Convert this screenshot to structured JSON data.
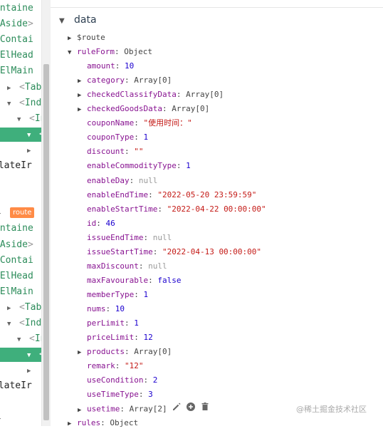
{
  "tree": {
    "rows": [
      {
        "text": "ontaine",
        "depth": 0,
        "kind": "name"
      },
      {
        "text": "lAside",
        "depth": 0,
        "kind": "name",
        "suffix": ">"
      },
      {
        "text": "lContai",
        "depth": 0,
        "kind": "name"
      },
      {
        "text": "ElHead",
        "depth": 0,
        "kind": "name",
        "prefix": "<"
      },
      {
        "text": "ElMain",
        "depth": 0,
        "kind": "name",
        "prefix": "<"
      },
      {
        "text": "Tab>",
        "depth": 1,
        "kind": "name",
        "prefix": "<",
        "arrow": "right"
      },
      {
        "text": "Inde",
        "depth": 1,
        "kind": "name",
        "prefix": "<",
        "arrow": "down"
      },
      {
        "text": "In",
        "depth": 2,
        "kind": "name",
        "prefix": "<",
        "arrow": "down"
      },
      {
        "text": "<",
        "depth": 3,
        "kind": "selected",
        "arrow": "down"
      },
      {
        "text": "",
        "depth": 3,
        "kind": "arrow-only",
        "arrow": "right"
      },
      {
        "text": "plateIr",
        "depth": 0,
        "kind": "plain"
      },
      {
        "text": "",
        "depth": 0,
        "kind": "blank"
      },
      {
        "text": "",
        "depth": 0,
        "kind": "blank"
      },
      {
        "text": "",
        "depth": 0,
        "kind": "route",
        "arrow": "right"
      },
      {
        "text": "ontaine",
        "depth": 0,
        "kind": "name"
      },
      {
        "text": "lAside",
        "depth": 0,
        "kind": "name",
        "suffix": ">"
      },
      {
        "text": "lContai",
        "depth": 0,
        "kind": "name"
      },
      {
        "text": "ElHead",
        "depth": 0,
        "kind": "name",
        "prefix": "<"
      },
      {
        "text": "ElMain",
        "depth": 0,
        "kind": "name",
        "prefix": "<"
      },
      {
        "text": "Tab>",
        "depth": 1,
        "kind": "name",
        "prefix": "<",
        "arrow": "right"
      },
      {
        "text": "Inde",
        "depth": 1,
        "kind": "name",
        "prefix": "<",
        "arrow": "down"
      },
      {
        "text": "In",
        "depth": 2,
        "kind": "name",
        "prefix": "<",
        "arrow": "down"
      },
      {
        "text": "<",
        "depth": 3,
        "kind": "selected",
        "arrow": "down"
      },
      {
        "text": "",
        "depth": 3,
        "kind": "arrow-only",
        "arrow": "right"
      },
      {
        "text": "plateIr",
        "depth": 0,
        "kind": "plain"
      },
      {
        "text": "",
        "depth": 0,
        "kind": "blank"
      },
      {
        "text": "",
        "depth": 0,
        "kind": "blank",
        "arrow": "right"
      }
    ],
    "route_tag": "route"
  },
  "inspector": {
    "section_title": "data",
    "rows": [
      {
        "key": "$route",
        "type": "expand",
        "expanded": false,
        "indent": 0
      },
      {
        "key": "ruleForm",
        "type": "object",
        "value": "Object",
        "expanded": true,
        "indent": 0
      },
      {
        "key": "amount",
        "type": "number",
        "value": "10",
        "indent": 1
      },
      {
        "key": "category",
        "type": "expand",
        "value": "Array[0]",
        "expanded": false,
        "indent": 1
      },
      {
        "key": "checkedClassifyData",
        "type": "expand",
        "value": "Array[0]",
        "expanded": false,
        "indent": 1
      },
      {
        "key": "checkedGoodsData",
        "type": "expand",
        "value": "Array[0]",
        "expanded": false,
        "indent": 1
      },
      {
        "key": "couponName",
        "type": "string",
        "value": "\"使用时间：\"",
        "indent": 1
      },
      {
        "key": "couponType",
        "type": "number",
        "value": "1",
        "indent": 1
      },
      {
        "key": "discount",
        "type": "string",
        "value": "\"\"",
        "indent": 1
      },
      {
        "key": "enableCommodityType",
        "type": "number",
        "value": "1",
        "indent": 1
      },
      {
        "key": "enableDay",
        "type": "null",
        "value": "null",
        "indent": 1
      },
      {
        "key": "enableEndTime",
        "type": "string",
        "value": "\"2022-05-20 23:59:59\"",
        "indent": 1
      },
      {
        "key": "enableStartTime",
        "type": "string",
        "value": "\"2022-04-22 00:00:00\"",
        "indent": 1
      },
      {
        "key": "id",
        "type": "number",
        "value": "46",
        "indent": 1
      },
      {
        "key": "issueEndTime",
        "type": "null",
        "value": "null",
        "indent": 1
      },
      {
        "key": "issueStartTime",
        "type": "string",
        "value": "\"2022-04-13 00:00:00\"",
        "indent": 1
      },
      {
        "key": "maxDiscount",
        "type": "null",
        "value": "null",
        "indent": 1
      },
      {
        "key": "maxFavourable",
        "type": "bool",
        "value": "false",
        "indent": 1
      },
      {
        "key": "memberType",
        "type": "number",
        "value": "1",
        "indent": 1
      },
      {
        "key": "nums",
        "type": "number",
        "value": "10",
        "indent": 1
      },
      {
        "key": "perLimit",
        "type": "number",
        "value": "1",
        "indent": 1
      },
      {
        "key": "priceLimit",
        "type": "number",
        "value": "12",
        "indent": 1
      },
      {
        "key": "products",
        "type": "expand",
        "value": "Array[0]",
        "expanded": false,
        "indent": 1
      },
      {
        "key": "remark",
        "type": "string",
        "value": "\"12\"",
        "indent": 1
      },
      {
        "key": "useCondition",
        "type": "number",
        "value": "2",
        "indent": 1
      },
      {
        "key": "useTimeType",
        "type": "number",
        "value": "3",
        "indent": 1
      },
      {
        "key": "usetime",
        "type": "expand",
        "value": "Array[2]",
        "expanded": false,
        "indent": 1,
        "actions": [
          "edit-icon",
          "add-icon",
          "delete-icon"
        ]
      },
      {
        "key": "rules",
        "type": "object",
        "value": "Object",
        "expanded": false,
        "indent": 0
      }
    ]
  },
  "watermark": "@稀土掘金技术社区",
  "colors": {
    "key": "#881391",
    "number": "#1c00cf",
    "string": "#c41a16",
    "null": "#999999",
    "selected_bg": "#3faf7c",
    "route_tag_bg": "#ff8b46"
  }
}
